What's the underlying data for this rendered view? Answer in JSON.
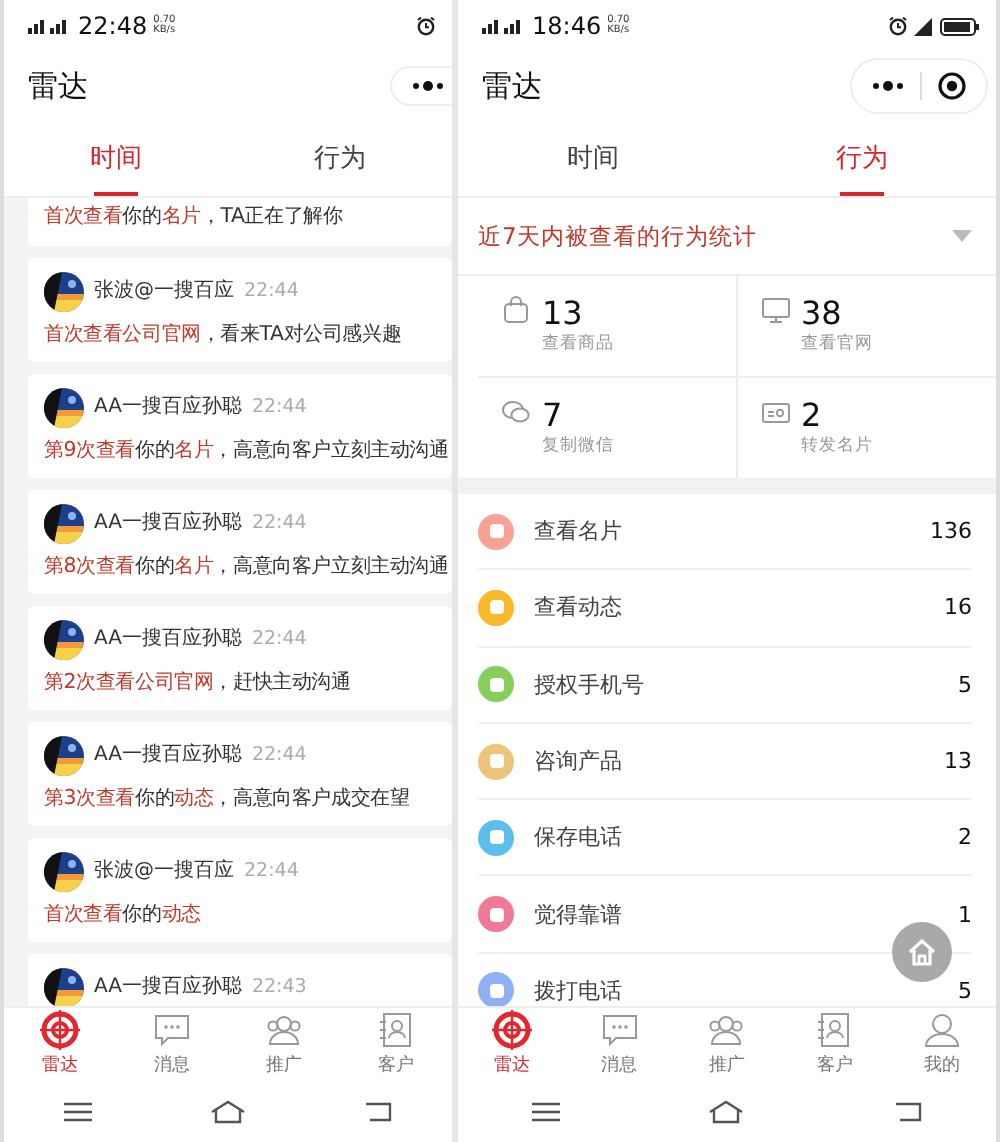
{
  "left_screen": {
    "status_bar": {
      "time": "22:48",
      "speed": "0.70",
      "speed_unit": "KB/s"
    },
    "title": "雷达",
    "tabs": [
      {
        "label": "时间",
        "selected": true
      },
      {
        "label": "行为",
        "selected": false
      }
    ],
    "feed": [
      {
        "message": [
          {
            "text": "首次查看",
            "highlight": true
          },
          {
            "text": "你的",
            "highlight": false
          },
          {
            "text": "名片",
            "highlight": true
          },
          {
            "text": "，TA正在了解你",
            "highlight": false
          }
        ]
      },
      {
        "author": "张波@一搜百应",
        "time": "22:44",
        "avatar": {
          "kind": "picture"
        },
        "message": [
          {
            "text": "首次查看公司官网",
            "highlight": true
          },
          {
            "text": "，看来TA对公司感兴趣",
            "highlight": false
          }
        ]
      },
      {
        "author": "AA一搜百应孙聪",
        "time": "22:44",
        "avatar": {
          "kind": "picture"
        },
        "message": [
          {
            "text": "第9次查看",
            "highlight": true
          },
          {
            "text": "你的",
            "highlight": false
          },
          {
            "text": "名片",
            "highlight": true
          },
          {
            "text": "，高意向客户立刻主动沟通",
            "highlight": false
          }
        ]
      },
      {
        "author": "AA一搜百应孙聪",
        "time": "22:44",
        "avatar": {
          "kind": "picture"
        },
        "message": [
          {
            "text": "第8次查看",
            "highlight": true
          },
          {
            "text": "你的",
            "highlight": false
          },
          {
            "text": "名片",
            "highlight": true
          },
          {
            "text": "，高意向客户立刻主动沟通",
            "highlight": false
          }
        ]
      },
      {
        "author": "AA一搜百应孙聪",
        "time": "22:44",
        "avatar": {
          "kind": "picture"
        },
        "message": [
          {
            "text": "第2次查看公司官网",
            "highlight": true
          },
          {
            "text": "，赶快主动沟通",
            "highlight": false
          }
        ]
      },
      {
        "author": "AA一搜百应孙聪",
        "time": "22:44",
        "avatar": {
          "kind": "picture"
        },
        "message": [
          {
            "text": "第3次查看",
            "highlight": true
          },
          {
            "text": "你的",
            "highlight": false
          },
          {
            "text": "动态",
            "highlight": true
          },
          {
            "text": "，高意向客户成交在望",
            "highlight": false
          }
        ]
      },
      {
        "author": "张波@一搜百应",
        "time": "22:44",
        "avatar": {
          "kind": "picture"
        },
        "message": [
          {
            "text": "首次查看",
            "highlight": true
          },
          {
            "text": "你的",
            "highlight": false
          },
          {
            "text": "动态",
            "highlight": true
          }
        ]
      },
      {
        "author": "AA一搜百应孙聪",
        "time": "22:43",
        "avatar": {
          "kind": "picture"
        }
      }
    ],
    "tab_bar": [
      {
        "label": "雷达",
        "selected": true
      },
      {
        "label": "消息",
        "selected": false
      },
      {
        "label": "推广",
        "selected": false
      },
      {
        "label": "客户",
        "selected": false
      }
    ]
  },
  "right_screen": {
    "status_bar": {
      "time": "18:46",
      "speed": "0.70",
      "speed_unit": "KB/s"
    },
    "title": "雷达",
    "tabs": [
      {
        "label": "时间",
        "selected": false
      },
      {
        "label": "行为",
        "selected": true
      }
    ],
    "stats_header": "近7天内被查看的行为统计",
    "stats": [
      {
        "value": "13",
        "label": "查看商品"
      },
      {
        "value": "38",
        "label": "查看官网"
      },
      {
        "value": "7",
        "label": "复制微信"
      },
      {
        "value": "2",
        "label": "转发名片"
      }
    ],
    "actions": [
      {
        "label": "查看名片",
        "count": "136",
        "color": "#f7a294"
      },
      {
        "label": "查看动态",
        "count": "16",
        "color": "#f9b82a"
      },
      {
        "label": "授权手机号",
        "count": "5",
        "color": "#86cf5a"
      },
      {
        "label": "咨询产品",
        "count": "13",
        "color": "#ecc57a"
      },
      {
        "label": "保存电话",
        "count": "2",
        "color": "#5bbfee"
      },
      {
        "label": "觉得靠谱",
        "count": "1",
        "color": "#f07a95"
      },
      {
        "label": "拨打电话",
        "count": "5",
        "color": "#8fb0f5"
      }
    ],
    "tab_bar": [
      {
        "label": "雷达",
        "selected": true
      },
      {
        "label": "消息",
        "selected": false
      },
      {
        "label": "推广",
        "selected": false
      },
      {
        "label": "客户",
        "selected": false
      },
      {
        "label": "我的",
        "selected": false
      }
    ]
  }
}
